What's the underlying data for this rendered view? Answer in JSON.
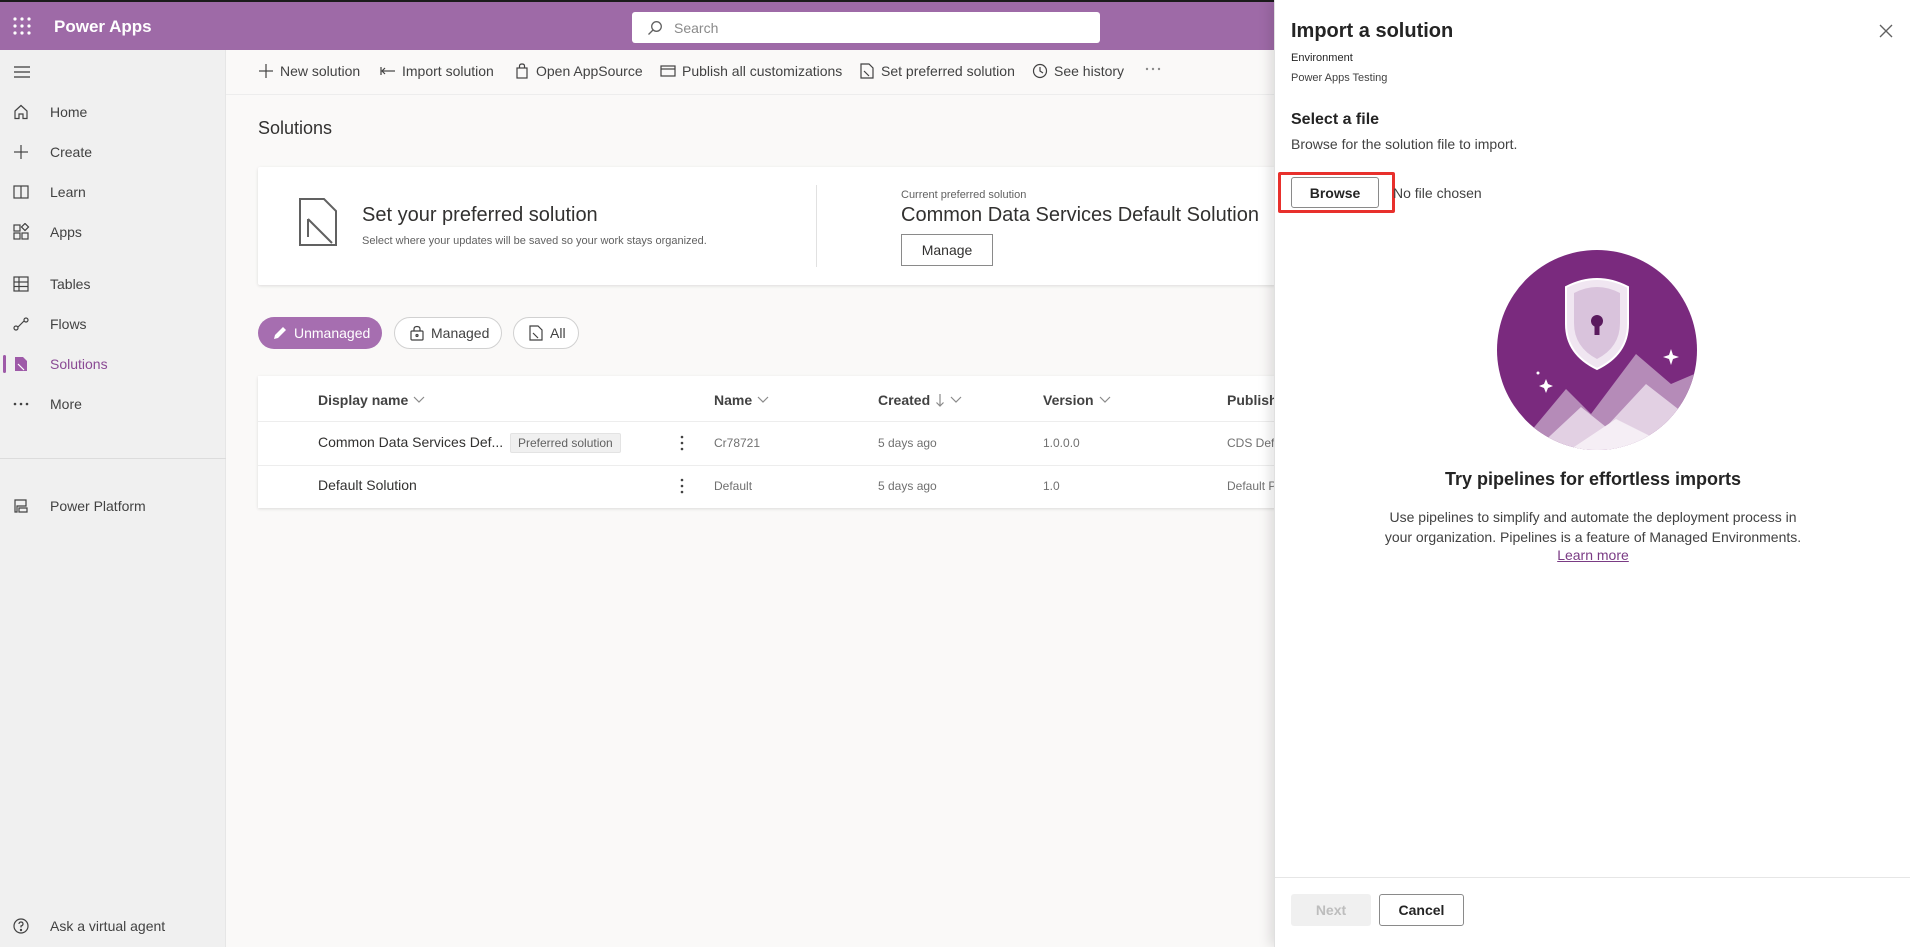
{
  "topbar": {
    "app_title": "Power Apps",
    "search_placeholder": "Search"
  },
  "sidebar": {
    "items": [
      {
        "label": "Home",
        "icon": "home-icon"
      },
      {
        "label": "Create",
        "icon": "plus-icon"
      },
      {
        "label": "Learn",
        "icon": "book-icon"
      },
      {
        "label": "Apps",
        "icon": "apps-icon"
      },
      {
        "label": "Tables",
        "icon": "table-icon"
      },
      {
        "label": "Flows",
        "icon": "flow-icon"
      },
      {
        "label": "Solutions",
        "icon": "solutions-icon",
        "active": true
      },
      {
        "label": "More",
        "icon": "more-icon"
      },
      {
        "label": "Power Platform",
        "icon": "power-platform-icon"
      }
    ],
    "virtual_agent": "Ask a virtual agent"
  },
  "commands": {
    "new_solution": "New solution",
    "import_solution": "Import solution",
    "open_appsource": "Open AppSource",
    "publish_all": "Publish all customizations",
    "set_preferred": "Set preferred solution",
    "see_history": "See history"
  },
  "page_title": "Solutions",
  "preferred_card": {
    "title": "Set your preferred solution",
    "subtitle": "Select where your updates will be saved so your work stays organized.",
    "current_label": "Current preferred solution",
    "current_name": "Common Data Services Default Solution",
    "manage_label": "Manage"
  },
  "filters": {
    "unmanaged": "Unmanaged",
    "managed": "Managed",
    "all": "All"
  },
  "table": {
    "headers": {
      "display_name": "Display name",
      "name": "Name",
      "created": "Created",
      "version": "Version",
      "publisher": "Publishe"
    },
    "rows": [
      {
        "display_name": "Common Data Services Def...",
        "badge": "Preferred solution",
        "name": "Cr78721",
        "created": "5 days ago",
        "version": "1.0.0.0",
        "publisher": "CDS Defa"
      },
      {
        "display_name": "Default Solution",
        "badge": "",
        "name": "Default",
        "created": "5 days ago",
        "version": "1.0",
        "publisher": "Default P"
      }
    ]
  },
  "panel": {
    "title": "Import a solution",
    "env_label": "Environment",
    "env_value": "Power Apps Testing",
    "select_title": "Select a file",
    "select_desc": "Browse for the solution file to import.",
    "browse_label": "Browse",
    "no_file": "No file chosen",
    "promo_title": "Try pipelines for effortless imports",
    "promo_desc": "Use pipelines to simplify and automate the deployment process in your organization. Pipelines is a feature of Managed Environments.",
    "learn_more": "Learn more",
    "next_label": "Next",
    "cancel_label": "Cancel"
  },
  "colors": {
    "brand": "#9e6aa7",
    "accent": "#a66eb0",
    "highlight": "#e8302c"
  }
}
